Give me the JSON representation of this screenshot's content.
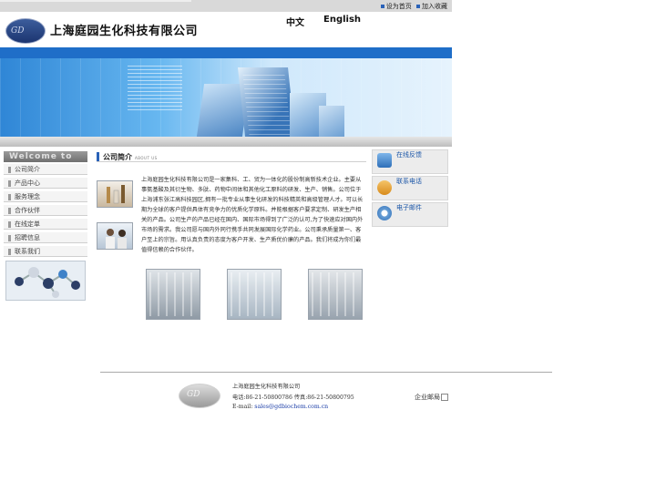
{
  "top_links": {
    "home": "设为首页",
    "favorite": "加入收藏"
  },
  "header": {
    "logo_text": "GD",
    "company_name": "上海庭园生化科技有限公司",
    "lang_zh": "中文",
    "lang_en": "English"
  },
  "sidebar": {
    "welcome": "Welcome to",
    "items": [
      {
        "label": "公司简介"
      },
      {
        "label": "产品中心"
      },
      {
        "label": "服务理念"
      },
      {
        "label": "合作伙伴"
      },
      {
        "label": "在线定单"
      },
      {
        "label": "招聘信息"
      },
      {
        "label": "联系我们"
      }
    ]
  },
  "main": {
    "section_title": "公司简介",
    "section_sub": "ABOUT US",
    "intro": "上海庭园生化科技有限公司是一家集科、工、贸为一体化的股份制高新技术企业。主要从事氨基酸及其衍生物、多肽、药物中间体和其他化工原料的研发、生产、销售。公司位于上海浦东张江高科技园区,拥有一批专业从事生化研发的科技精英和高级管理人才。可以长期为全球的客户提供具体有竞争力的优质化学原料。并能根据客户要求定制、研发生产相关的产品。公司生产的产品已经在国内、国际市场得到了广泛的认可,为了快速应对国内外市场的需求。我公司愿与国内外同行携手共同发展国际化学药业。公司秉承质量第一、客户至上的宗旨。用认真负责的态度为客户开发、生产质优价廉的产品。我们将成为你们最值得信赖的合作伙伴。"
  },
  "right": {
    "feedback": "在线反馈",
    "phone": "联系电话",
    "email": "电子邮件"
  },
  "footer": {
    "logo_text": "GD",
    "company": "上海庭园生化科技有限公司",
    "tel_line": "电话:86-21-50800786 传真:86-21-50800795",
    "email_label": "E-mail:",
    "email": "sales@gdbiochem.com.cn",
    "mailbox": "企业邮局"
  },
  "colors": {
    "accent": "#2a62b8",
    "banner": "#2f86d6"
  }
}
